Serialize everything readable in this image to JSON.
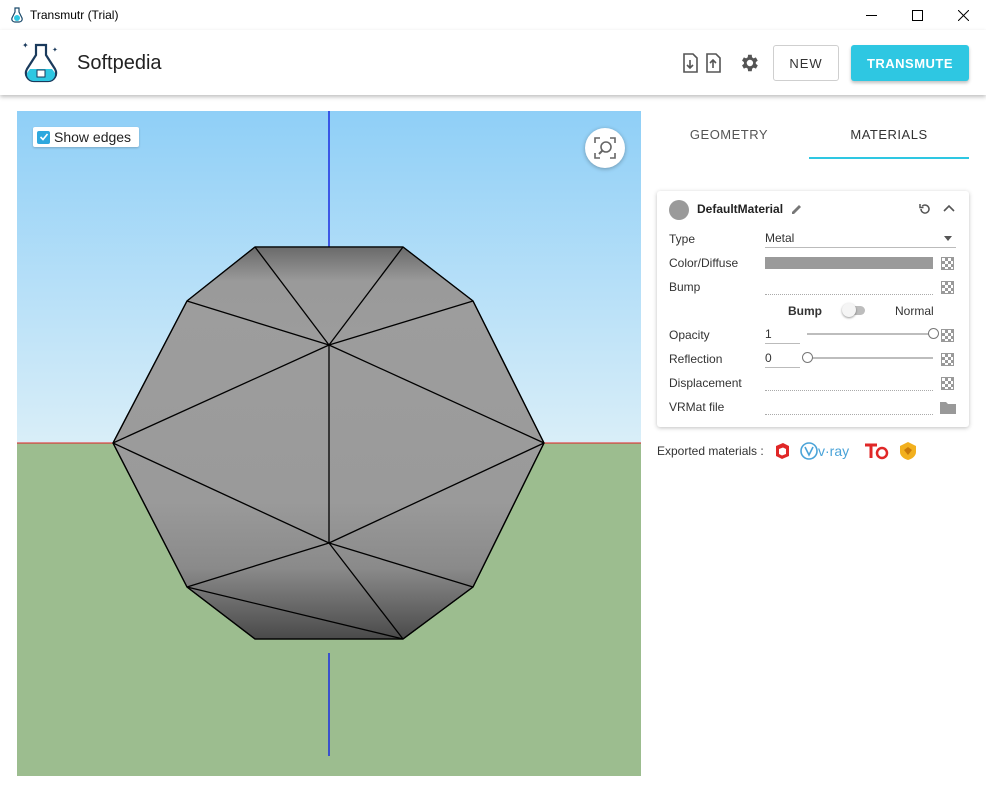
{
  "window": {
    "title": "Transmutr (Trial)"
  },
  "header": {
    "brand": "Softpedia",
    "new_label": "NEW",
    "transmute_label": "TRANSMUTE",
    "accent": "#2ec7e2"
  },
  "viewport": {
    "show_edges_label": "Show edges",
    "show_edges_checked": true,
    "sky_color": "#8fcff7",
    "ground_color": "#9cbd8f"
  },
  "tabs": [
    {
      "label": "GEOMETRY",
      "active": false
    },
    {
      "label": "MATERIALS",
      "active": true
    }
  ],
  "material": {
    "name": "DefaultMaterial",
    "swatch_color": "#9a9a9a",
    "rows": {
      "type_label": "Type",
      "type_value": "Metal",
      "color_label": "Color/Diffuse",
      "bump_label": "Bump",
      "bump_toggle_left": "Bump",
      "bump_toggle_right": "Normal",
      "opacity_label": "Opacity",
      "opacity_value": "1",
      "opacity_level": 1.0,
      "reflection_label": "Reflection",
      "reflection_value": "0",
      "reflection_level": 0.0,
      "displacement_label": "Displacement",
      "vrmat_label": "VRMat file"
    }
  },
  "exported": {
    "label": "Exported materials :",
    "icons": [
      "sketchup-icon",
      "vray-icon",
      "thea-icon",
      "enscape-icon"
    ],
    "vray_text": "v·ray"
  }
}
